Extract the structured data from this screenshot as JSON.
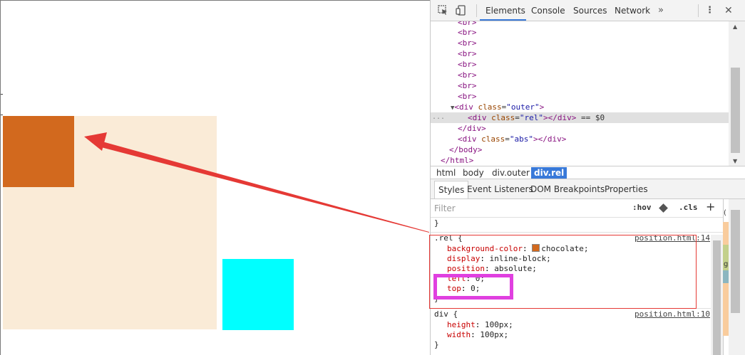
{
  "page": {
    "boxes": [
      {
        "name": "outer",
        "color": "#faebd7"
      },
      {
        "name": "rel",
        "color": "#d2691e"
      },
      {
        "name": "abs",
        "color": "#00ffff"
      }
    ]
  },
  "devtools": {
    "tabs": [
      "Elements",
      "Console",
      "Sources",
      "Network"
    ],
    "active_tab": "Elements",
    "more_tabs": "»",
    "menu_icon": "⋮",
    "close_icon": "✕",
    "tree": {
      "br": "br",
      "div": "div",
      "class_attr": "class",
      "outer_val": "\"outer\"",
      "rel_val": "\"rel\"",
      "abs_val": "\"abs\"",
      "eq_dollar": " == $0",
      "dots": "...",
      "body": "body",
      "html": "html"
    },
    "breadcrumbs": [
      "html",
      "body",
      "div.outer",
      "div.rel"
    ],
    "styles_tabs": [
      "Styles",
      "Event Listeners",
      "DOM Breakpoints",
      "Properties"
    ],
    "filter_placeholder": "Filter",
    "hov": ":hov",
    "cls": ".cls",
    "plus": "+",
    "rules": {
      "closing_brace": "}",
      "rel": {
        "selector": ".rel {",
        "source": "position.html:14",
        "props": [
          {
            "name": "background-color",
            "value": "chocolate;"
          },
          {
            "name": "display",
            "value": "inline-block;"
          },
          {
            "name": "position",
            "value": "absolute;"
          },
          {
            "name": "left",
            "value": "0;"
          },
          {
            "name": "top",
            "value": "0;"
          }
        ]
      },
      "div": {
        "selector": "div {",
        "source": "position.html:10",
        "props": [
          {
            "name": "height",
            "value": "100px;"
          },
          {
            "name": "width",
            "value": "100px;"
          }
        ]
      }
    },
    "right_strip_chars": [
      "(",
      "g"
    ]
  },
  "annotations": {
    "red_color": "#e53935",
    "magenta_color": "#e040e0"
  }
}
